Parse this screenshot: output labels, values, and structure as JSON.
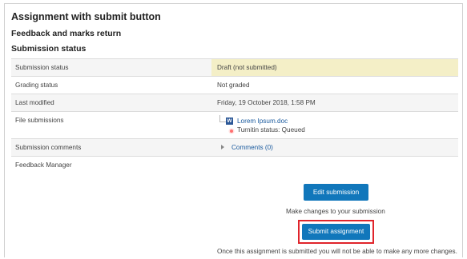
{
  "page": {
    "title": "Assignment with submit button",
    "subtitle": "Feedback and marks return",
    "section_title": "Submission status"
  },
  "rows": {
    "submission_status": {
      "label": "Submission status",
      "value": "Draft (not submitted)"
    },
    "grading_status": {
      "label": "Grading status",
      "value": "Not graded"
    },
    "last_modified": {
      "label": "Last modified",
      "value": "Friday, 19 October 2018, 1:58 PM"
    },
    "file_submissions": {
      "label": "File submissions",
      "file_name": "Lorem Ipsum.doc",
      "file_icon": "word-doc-icon",
      "file_icon_letter": "W",
      "turnitin_status": "Turnitin status: Queued"
    },
    "submission_comments": {
      "label": "Submission comments",
      "link": "Comments (0)"
    },
    "feedback_manager": {
      "label": "Feedback Manager"
    }
  },
  "actions": {
    "edit_button": "Edit submission",
    "edit_help": "Make changes to your submission",
    "submit_button": "Submit assignment",
    "submit_help": "Once this assignment is submitted you will not be able to make any more changes."
  },
  "colors": {
    "accent": "#1177bb",
    "highlight_border": "#e0242b",
    "draft_background": "#f4efc7",
    "link": "#1a5a9e"
  }
}
